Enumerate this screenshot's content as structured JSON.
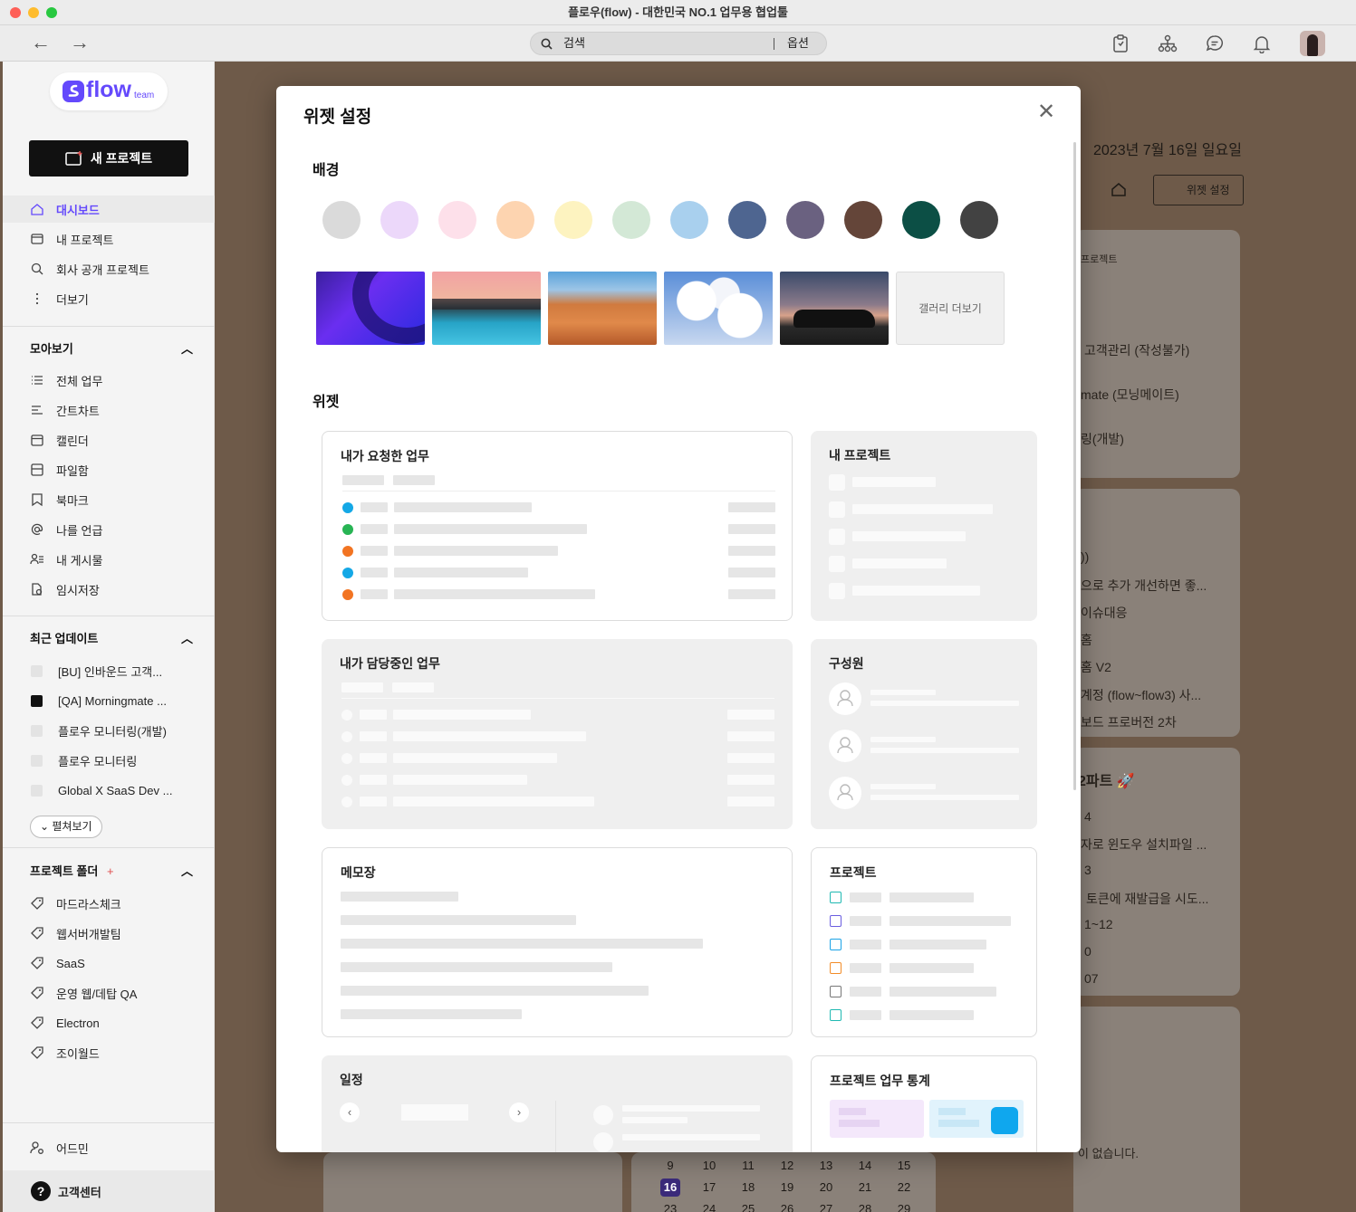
{
  "window": {
    "title": "플로우(flow) - 대한민국 NO.1 업무용 협업툴"
  },
  "toolbar": {
    "search_label": "검색",
    "options_label": "옵션"
  },
  "sidebar": {
    "logo": "flow",
    "logo_sub": "team",
    "new_project": "새 프로젝트",
    "main_items": [
      {
        "label": "대시보드",
        "icon": "home-icon",
        "active": true
      },
      {
        "label": "내 프로젝트",
        "icon": "folder-icon"
      },
      {
        "label": "회사 공개 프로젝트",
        "icon": "search-icon"
      },
      {
        "label": "더보기",
        "icon": "more-vertical-icon"
      }
    ],
    "collect": {
      "title": "모아보기",
      "items": [
        {
          "label": "전체 업무",
          "icon": "list-icon"
        },
        {
          "label": "간트차트",
          "icon": "gantt-icon"
        },
        {
          "label": "캘린더",
          "icon": "calendar-icon"
        },
        {
          "label": "파일함",
          "icon": "file-box-icon"
        },
        {
          "label": "북마크",
          "icon": "bookmark-icon"
        },
        {
          "label": "나를 언급",
          "icon": "mention-icon"
        },
        {
          "label": "내 게시물",
          "icon": "my-posts-icon"
        },
        {
          "label": "임시저장",
          "icon": "draft-icon"
        }
      ]
    },
    "recent": {
      "title": "최근 업데이트",
      "items": [
        {
          "label": "[BU] 인바운드 고객...",
          "color": "#e3e3e3"
        },
        {
          "label": "[QA] Morningmate ...",
          "color": "#111111"
        },
        {
          "label": "플로우 모니터링(개발)",
          "color": "#e3e3e3"
        },
        {
          "label": "플로우 모니터링",
          "color": "#e3e3e3"
        },
        {
          "label": "Global X SaaS Dev ...",
          "color": "#e3e3e3"
        }
      ],
      "expand": "펼쳐보기"
    },
    "folders": {
      "title": "프로젝트 폴더",
      "add": "+",
      "items": [
        "마드라스체크",
        "웹서버개발팀",
        "SaaS",
        "운영 웹/데탑 QA",
        "Electron",
        "조이월드"
      ]
    },
    "admin": "어드민",
    "help": "고객센터",
    "help_icon": "?"
  },
  "background_page": {
    "date": "2023년 7월 16일 일요일",
    "widget_btn": "위젯 설정",
    "card1_head": "프로젝트",
    "card1": [
      "고객관리 (작성불가)",
      "mate (모닝메이트)",
      "링(개발)"
    ],
    "card2": [
      "))",
      "으로 추가 개선하면 좋...",
      "이슈대응",
      "홈",
      "홈 V2",
      "계정 (flow~flow3) 사...",
      "보드 프로버전 2차"
    ],
    "card3_title": "2파트 🚀",
    "card3": [
      "4",
      "자로 윈도우 설치파일 ...",
      "3",
      "토큰에 재발급을 시도...",
      "1~12",
      "0",
      "07"
    ],
    "no_schedule": "이 없습니다.",
    "cal_row1": [
      "9",
      "10",
      "11",
      "12",
      "13",
      "14",
      "15"
    ],
    "cal_row2": [
      "16",
      "17",
      "18",
      "19",
      "20",
      "21",
      "22"
    ],
    "cal_row3": [
      "23",
      "24",
      "25",
      "26",
      "27",
      "28",
      "29"
    ]
  },
  "modal": {
    "title": "위젯 설정",
    "bg_title": "배경",
    "colors": [
      "#dadada",
      "#ecd8fa",
      "#fde0ea",
      "#fdd4b0",
      "#fdf3c0",
      "#d3e8d6",
      "#a9d0ee",
      "#4e6590",
      "#6a6180",
      "#644539",
      "#0c4f45",
      "#424242"
    ],
    "gallery_more": "갤러리 더보기",
    "widget_title": "위젯",
    "widgets": {
      "req": "내가 요청한 업무",
      "myproj": "내 프로젝트",
      "assigned": "내가 담당중인 업무",
      "members": "구성원",
      "memo": "메모장",
      "projects": "프로젝트",
      "schedule": "일정",
      "stats": "프로젝트 업무 통계"
    }
  }
}
